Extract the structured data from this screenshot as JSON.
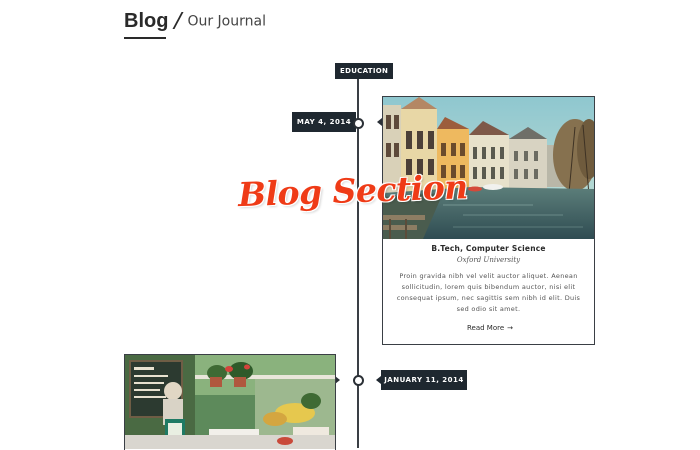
{
  "header": {
    "title": "Blog",
    "subtitle": "Our Journal"
  },
  "overlay": {
    "text": "Blog Section"
  },
  "timeline": {
    "category": "EDUCATION",
    "posts": [
      {
        "date": "MAY 4, 2014",
        "title": "B.Tech, Computer Science",
        "subtitle": "Oxford University",
        "excerpt": "Proin gravida nibh vel velit auctor aliquet. Aenean sollicitudin, lorem quis bibendum auctor, nisi elit consequat ipsum, nec sagittis sem nibh id elit. Duis sed odio sit amet.",
        "read_more": "Read More",
        "read_more_arrow": "→"
      },
      {
        "date": "JANUARY 11, 2014"
      }
    ]
  },
  "colors": {
    "accent": "#ef3b17",
    "badge": "#1f2830",
    "line": "#3a3f45"
  }
}
